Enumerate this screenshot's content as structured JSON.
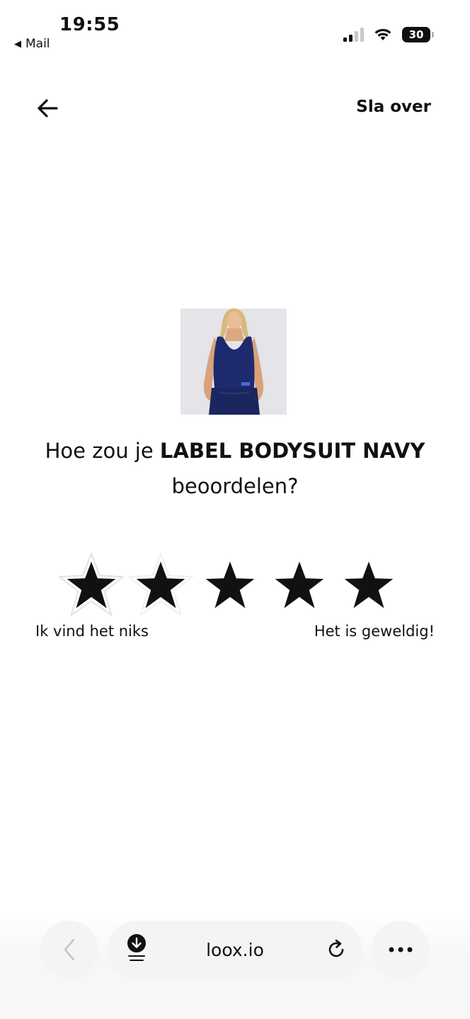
{
  "status_bar": {
    "time": "19:55",
    "back_app": "Mail",
    "battery": "30"
  },
  "header": {
    "skip_label": "Sla over"
  },
  "product": {
    "question_prefix": "Hoe zou je ",
    "product_name": "LABEL BODYSUIT NAVY",
    "question_suffix": "beoordelen?"
  },
  "rating": {
    "max_stars": 5,
    "label_low": "Ik vind het niks",
    "label_high": "Het is geweldig!"
  },
  "browser": {
    "url": "loox.io"
  }
}
